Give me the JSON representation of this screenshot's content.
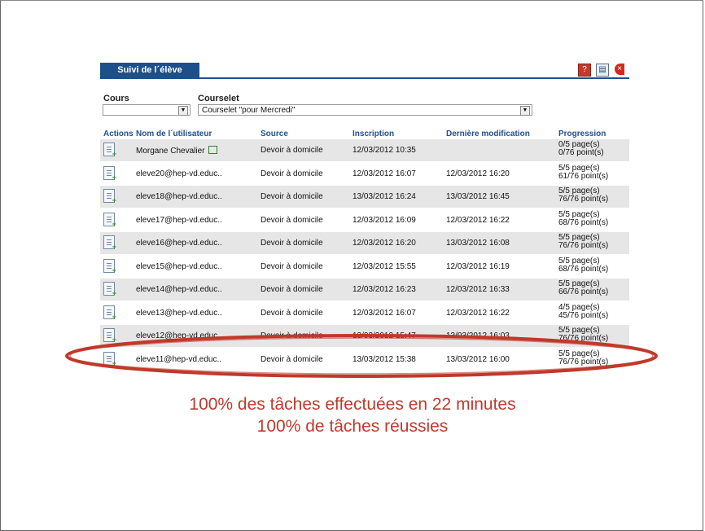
{
  "tab": "Suivi de l´élève",
  "filters": {
    "cours_label": "Cours",
    "courselet_label": "Courselet",
    "cours_value": "",
    "courselet_value": "Courselet \"pour Mercredi\""
  },
  "table": {
    "headers": [
      "Actions",
      "Nom de l´utilisateur",
      "Source",
      "Inscription",
      "Dernière modification",
      "Progression"
    ],
    "rows": [
      {
        "name": "Morgane Chevalier",
        "source": "Devoir à domicile",
        "inscription": "12/03/2012 10:35",
        "modification": "",
        "pages": "0/5 page(s)",
        "points": "0/76 point(s)"
      },
      {
        "name": "eleve20@hep-vd.educ..",
        "source": "Devoir à domicile",
        "inscription": "12/03/2012 16:07",
        "modification": "12/03/2012 16:20",
        "pages": "5/5 page(s)",
        "points": "61/76 point(s)"
      },
      {
        "name": "eleve18@hep-vd.educ..",
        "source": "Devoir à domicile",
        "inscription": "13/03/2012 16:24",
        "modification": "13/03/2012 16:45",
        "pages": "5/5 page(s)",
        "points": "76/76 point(s)"
      },
      {
        "name": "eleve17@hep-vd.educ..",
        "source": "Devoir à domicile",
        "inscription": "12/03/2012 16:09",
        "modification": "12/03/2012 16:22",
        "pages": "5/5 page(s)",
        "points": "68/76 point(s)"
      },
      {
        "name": "eleve16@hep-vd.educ..",
        "source": "Devoir à domicile",
        "inscription": "12/03/2012 16:20",
        "modification": "13/03/2012 16:08",
        "pages": "5/5 page(s)",
        "points": "76/76 point(s)"
      },
      {
        "name": "eleve15@hep-vd.educ..",
        "source": "Devoir à domicile",
        "inscription": "12/03/2012 15:55",
        "modification": "12/03/2012 16:19",
        "pages": "5/5 page(s)",
        "points": "68/76 point(s)"
      },
      {
        "name": "eleve14@hep-vd.educ..",
        "source": "Devoir à domicile",
        "inscription": "12/03/2012 16:23",
        "modification": "12/03/2012 16:33",
        "pages": "5/5 page(s)",
        "points": "66/76 point(s)"
      },
      {
        "name": "eleve13@hep-vd.educ..",
        "source": "Devoir à domicile",
        "inscription": "12/03/2012 16:07",
        "modification": "12/03/2012 16:22",
        "pages": "4/5 page(s)",
        "points": "45/76 point(s)"
      },
      {
        "name": "eleve12@hep-vd.educ..",
        "source": "Devoir à domicile",
        "inscription": "13/03/2012 15:47",
        "modification": "13/03/2012 16:03",
        "pages": "5/5 page(s)",
        "points": "76/76 point(s)"
      },
      {
        "name": "eleve11@hep-vd.educ..",
        "source": "Devoir à domicile",
        "inscription": "13/03/2012 15:38",
        "modification": "13/03/2012 16:00",
        "pages": "5/5 page(s)",
        "points": "76/76 point(s)"
      }
    ]
  },
  "toolbar_icons": [
    "help-icon",
    "print-icon",
    "close-icon"
  ],
  "highlight_color": "#c0392b",
  "caption": {
    "line1": "100% des tâches effectuées en 22 minutes",
    "line2": "100% de tâches réussies"
  }
}
